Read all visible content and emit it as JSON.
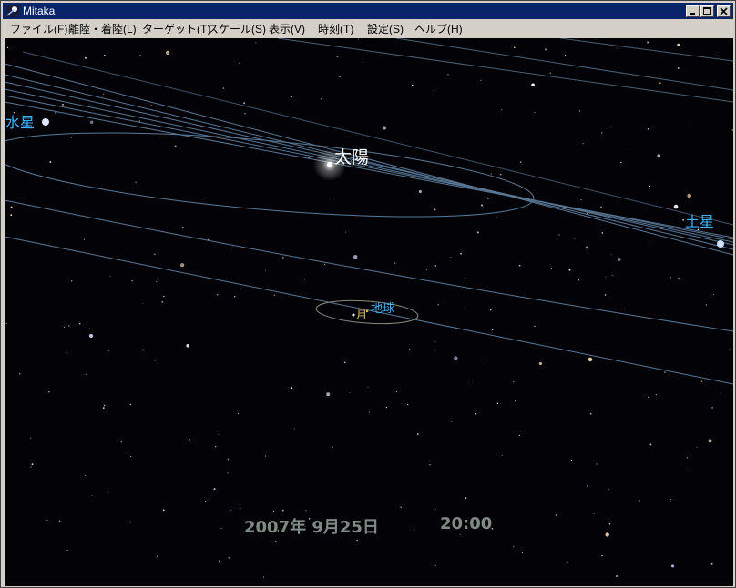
{
  "window": {
    "title": "Mitaka"
  },
  "menu": {
    "items": [
      "ファイル(F)",
      "離陸・着陸(L)",
      "ターゲット(T)",
      "スケール(S)",
      "表示(V)",
      "時刻(T)",
      "設定(S)",
      "ヘルプ(H)"
    ]
  },
  "sky": {
    "labels": {
      "sun": "太陽",
      "mercury": "水星",
      "saturn": "土星",
      "earth": "地球",
      "moon": "月"
    },
    "orbit_color": "#5a7896",
    "label_color": "#3cb6ff"
  },
  "datetime": {
    "date": "2007年  9月25日",
    "time": "20:00"
  }
}
